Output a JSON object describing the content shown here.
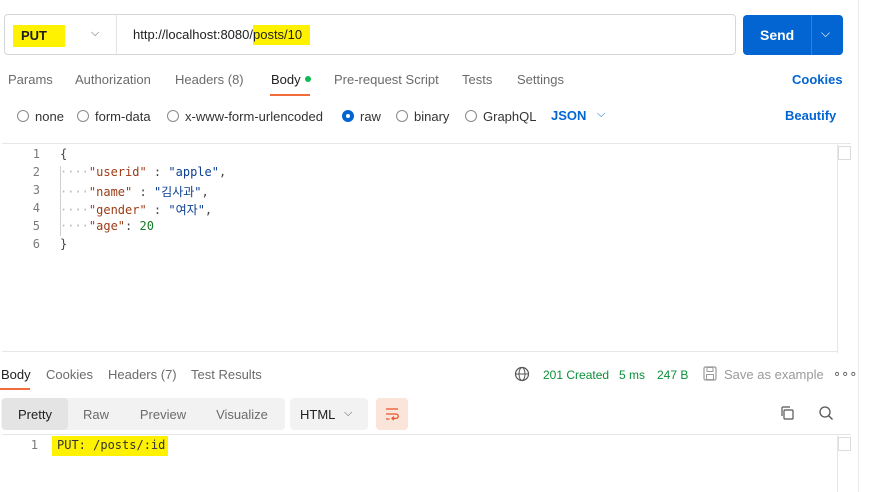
{
  "request": {
    "method": "PUT",
    "url_prefix": "http://localhost:8080/",
    "url_highlight": "posts/10",
    "send_label": "Send"
  },
  "request_tabs": [
    {
      "label": "Params"
    },
    {
      "label": "Authorization"
    },
    {
      "label": "Headers (8)"
    },
    {
      "label": "Body"
    },
    {
      "label": "Pre-request Script"
    },
    {
      "label": "Tests"
    },
    {
      "label": "Settings"
    }
  ],
  "cookies_label": "Cookies",
  "body_types": [
    {
      "label": "none"
    },
    {
      "label": "form-data"
    },
    {
      "label": "x-www-form-urlencoded"
    },
    {
      "label": "raw"
    },
    {
      "label": "binary"
    },
    {
      "label": "GraphQL"
    }
  ],
  "raw_format": "JSON",
  "beautify_label": "Beautify",
  "request_body": {
    "line_numbers": [
      "1",
      "2",
      "3",
      "4",
      "5",
      "6"
    ],
    "open_brace": "{",
    "close_brace": "}",
    "dots": "····",
    "fields": [
      {
        "key": "\"userid\"",
        "sep": " : ",
        "value": "\"apple\"",
        "comma": ","
      },
      {
        "key": "\"name\"",
        "sep": " : ",
        "value": "\"김사과\"",
        "comma": ","
      },
      {
        "key": "\"gender\"",
        "sep": " : ",
        "value": "\"여자\"",
        "comma": ","
      },
      {
        "key": "\"age\"",
        "sep": ": ",
        "value": "20",
        "comma": ""
      }
    ]
  },
  "response_tabs": [
    {
      "label": "Body"
    },
    {
      "label": "Cookies"
    },
    {
      "label": "Headers (7)"
    },
    {
      "label": "Test Results"
    }
  ],
  "response_meta": {
    "status": "201 Created",
    "time": "5 ms",
    "size": "247 B",
    "save_example": "Save as example"
  },
  "view_modes": [
    {
      "label": "Pretty"
    },
    {
      "label": "Raw"
    },
    {
      "label": "Preview"
    },
    {
      "label": "Visualize"
    }
  ],
  "response_format": "HTML",
  "response_body": {
    "line_number": "1",
    "text": "PUT: /posts/:id"
  },
  "colors": {
    "accent": "#0265d2",
    "highlight": "#fff200",
    "tab_underline": "#f26b3a",
    "status_ok": "#0a8f3a"
  }
}
